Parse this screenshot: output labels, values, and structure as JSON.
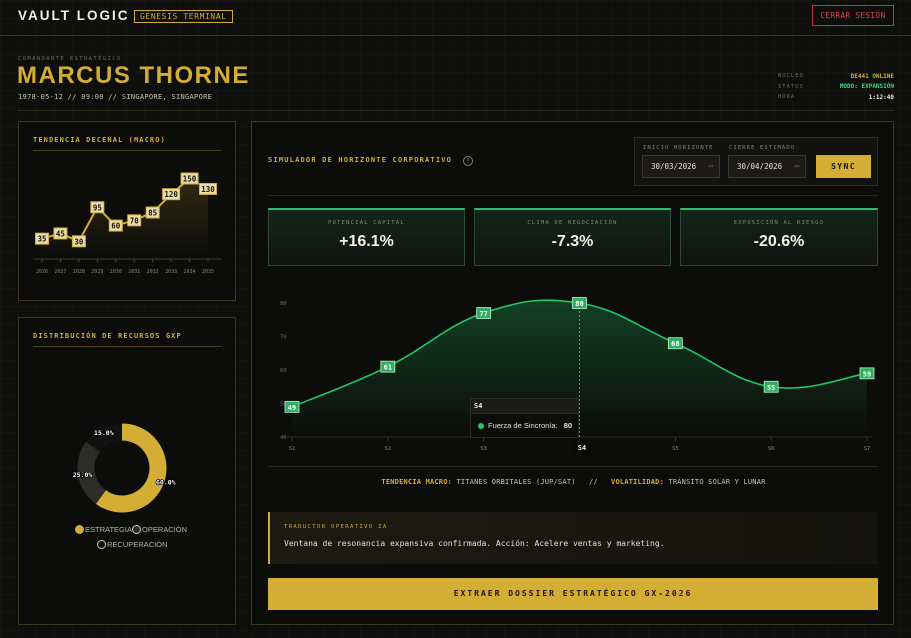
{
  "header": {
    "brand": "VAULT LOGIC",
    "tag": "GÉNESIS TERMINAL",
    "logout_label": "CERRAR SESIÓN"
  },
  "identity": {
    "role": "COMANDANTE ESTRATÉGICO",
    "name": "MARCUS THORNE",
    "birth": "1978-05-12 // 09:00 // SINGAPORE, SINGAPORE"
  },
  "status": [
    {
      "key": "NUCLEO",
      "value": "DE441 ONLINE",
      "color": "#d4ad35"
    },
    {
      "key": "STATUS",
      "value": "MODO: EXPANSIÓN",
      "color": "#3ed67a"
    },
    {
      "key": "HORA",
      "value": "1:12:40",
      "color": "#f0ece0"
    }
  ],
  "trend_panel": {
    "title": "TENDENCIA DECENAL (MACRO)",
    "chart_data": {
      "type": "line",
      "categories": [
        "2026",
        "2027",
        "2028",
        "2029",
        "2030",
        "2031",
        "2032",
        "2033",
        "2034",
        "2035"
      ],
      "values": [
        35,
        45,
        30,
        95,
        60,
        70,
        85,
        120,
        150,
        130
      ],
      "ylim": [
        0,
        170
      ]
    }
  },
  "distribution_panel": {
    "title": "DISTRIBUCIÓN DE RECURSOS GXP",
    "chart_data": {
      "type": "pie",
      "categories": [
        "ESTRATEGIA",
        "OPERACIÓN",
        "RECUPERACIÓN"
      ],
      "values": [
        60.0,
        25.0,
        15.0
      ],
      "labels": [
        "60.0%",
        "25.0%",
        "15.0%"
      ],
      "colors": [
        "#d4ad35",
        "#2e2c28",
        "#111110"
      ]
    },
    "legend": [
      {
        "label": "ESTRATEGIA",
        "color": "#d4ad35"
      },
      {
        "label": "OPERACIÓN",
        "color": "#2e2c28"
      },
      {
        "label": "RECUPERACIÓN",
        "color": "#111110"
      }
    ]
  },
  "simulator": {
    "title": "SIMULADOR DE HORIZONTE CORPORATIVO",
    "help": "?",
    "start_label": "INICIO HORIZONTE",
    "start_value": "30/03/2026",
    "end_label": "CIERRE ESTIMADO",
    "end_value": "30/04/2026",
    "sync_label": "SYNC",
    "metrics": [
      {
        "label": "POTENCIAL CAPITAL",
        "value": "+16.1%"
      },
      {
        "label": "CLIMA DE NEGOCIACIÓN",
        "value": "-7.3%"
      },
      {
        "label": "EXPOSICIÓN AL RIESGO",
        "value": "-20.6%"
      }
    ],
    "chart_data": {
      "type": "area",
      "categories": [
        "S1",
        "S2",
        "S3",
        "S4",
        "S5",
        "S6",
        "S7"
      ],
      "series": [
        {
          "name": "Fuerza de Sincronía",
          "values": [
            49,
            61,
            77,
            80,
            68,
            55,
            59
          ]
        }
      ],
      "yticks": [
        40,
        50,
        60,
        70,
        80
      ],
      "ylim": [
        40,
        80
      ],
      "color": "#22c864"
    },
    "tooltip": {
      "title": "S4",
      "label": "Fuerza de Sincronía",
      "value": "80",
      "axis_label": "S4"
    },
    "macro": {
      "trend_label": "TENDENCIA MACRO:",
      "trend_value": "TITANES ORBITALES (JUP/SAT)",
      "divider": "//",
      "vol_label": "VOLATILIDAD:",
      "vol_value": "TRÁNSITO SOLAR Y LUNAR"
    },
    "translator": {
      "label": "TRADUCTOR OPERATIVO IA",
      "text": "Ventana de resonancia expansiva confirmada. Acción: Acelere ventas y marketing."
    },
    "dossier_label": "EXTRAER DOSSIER ESTRATÉGICO GX-2026"
  }
}
